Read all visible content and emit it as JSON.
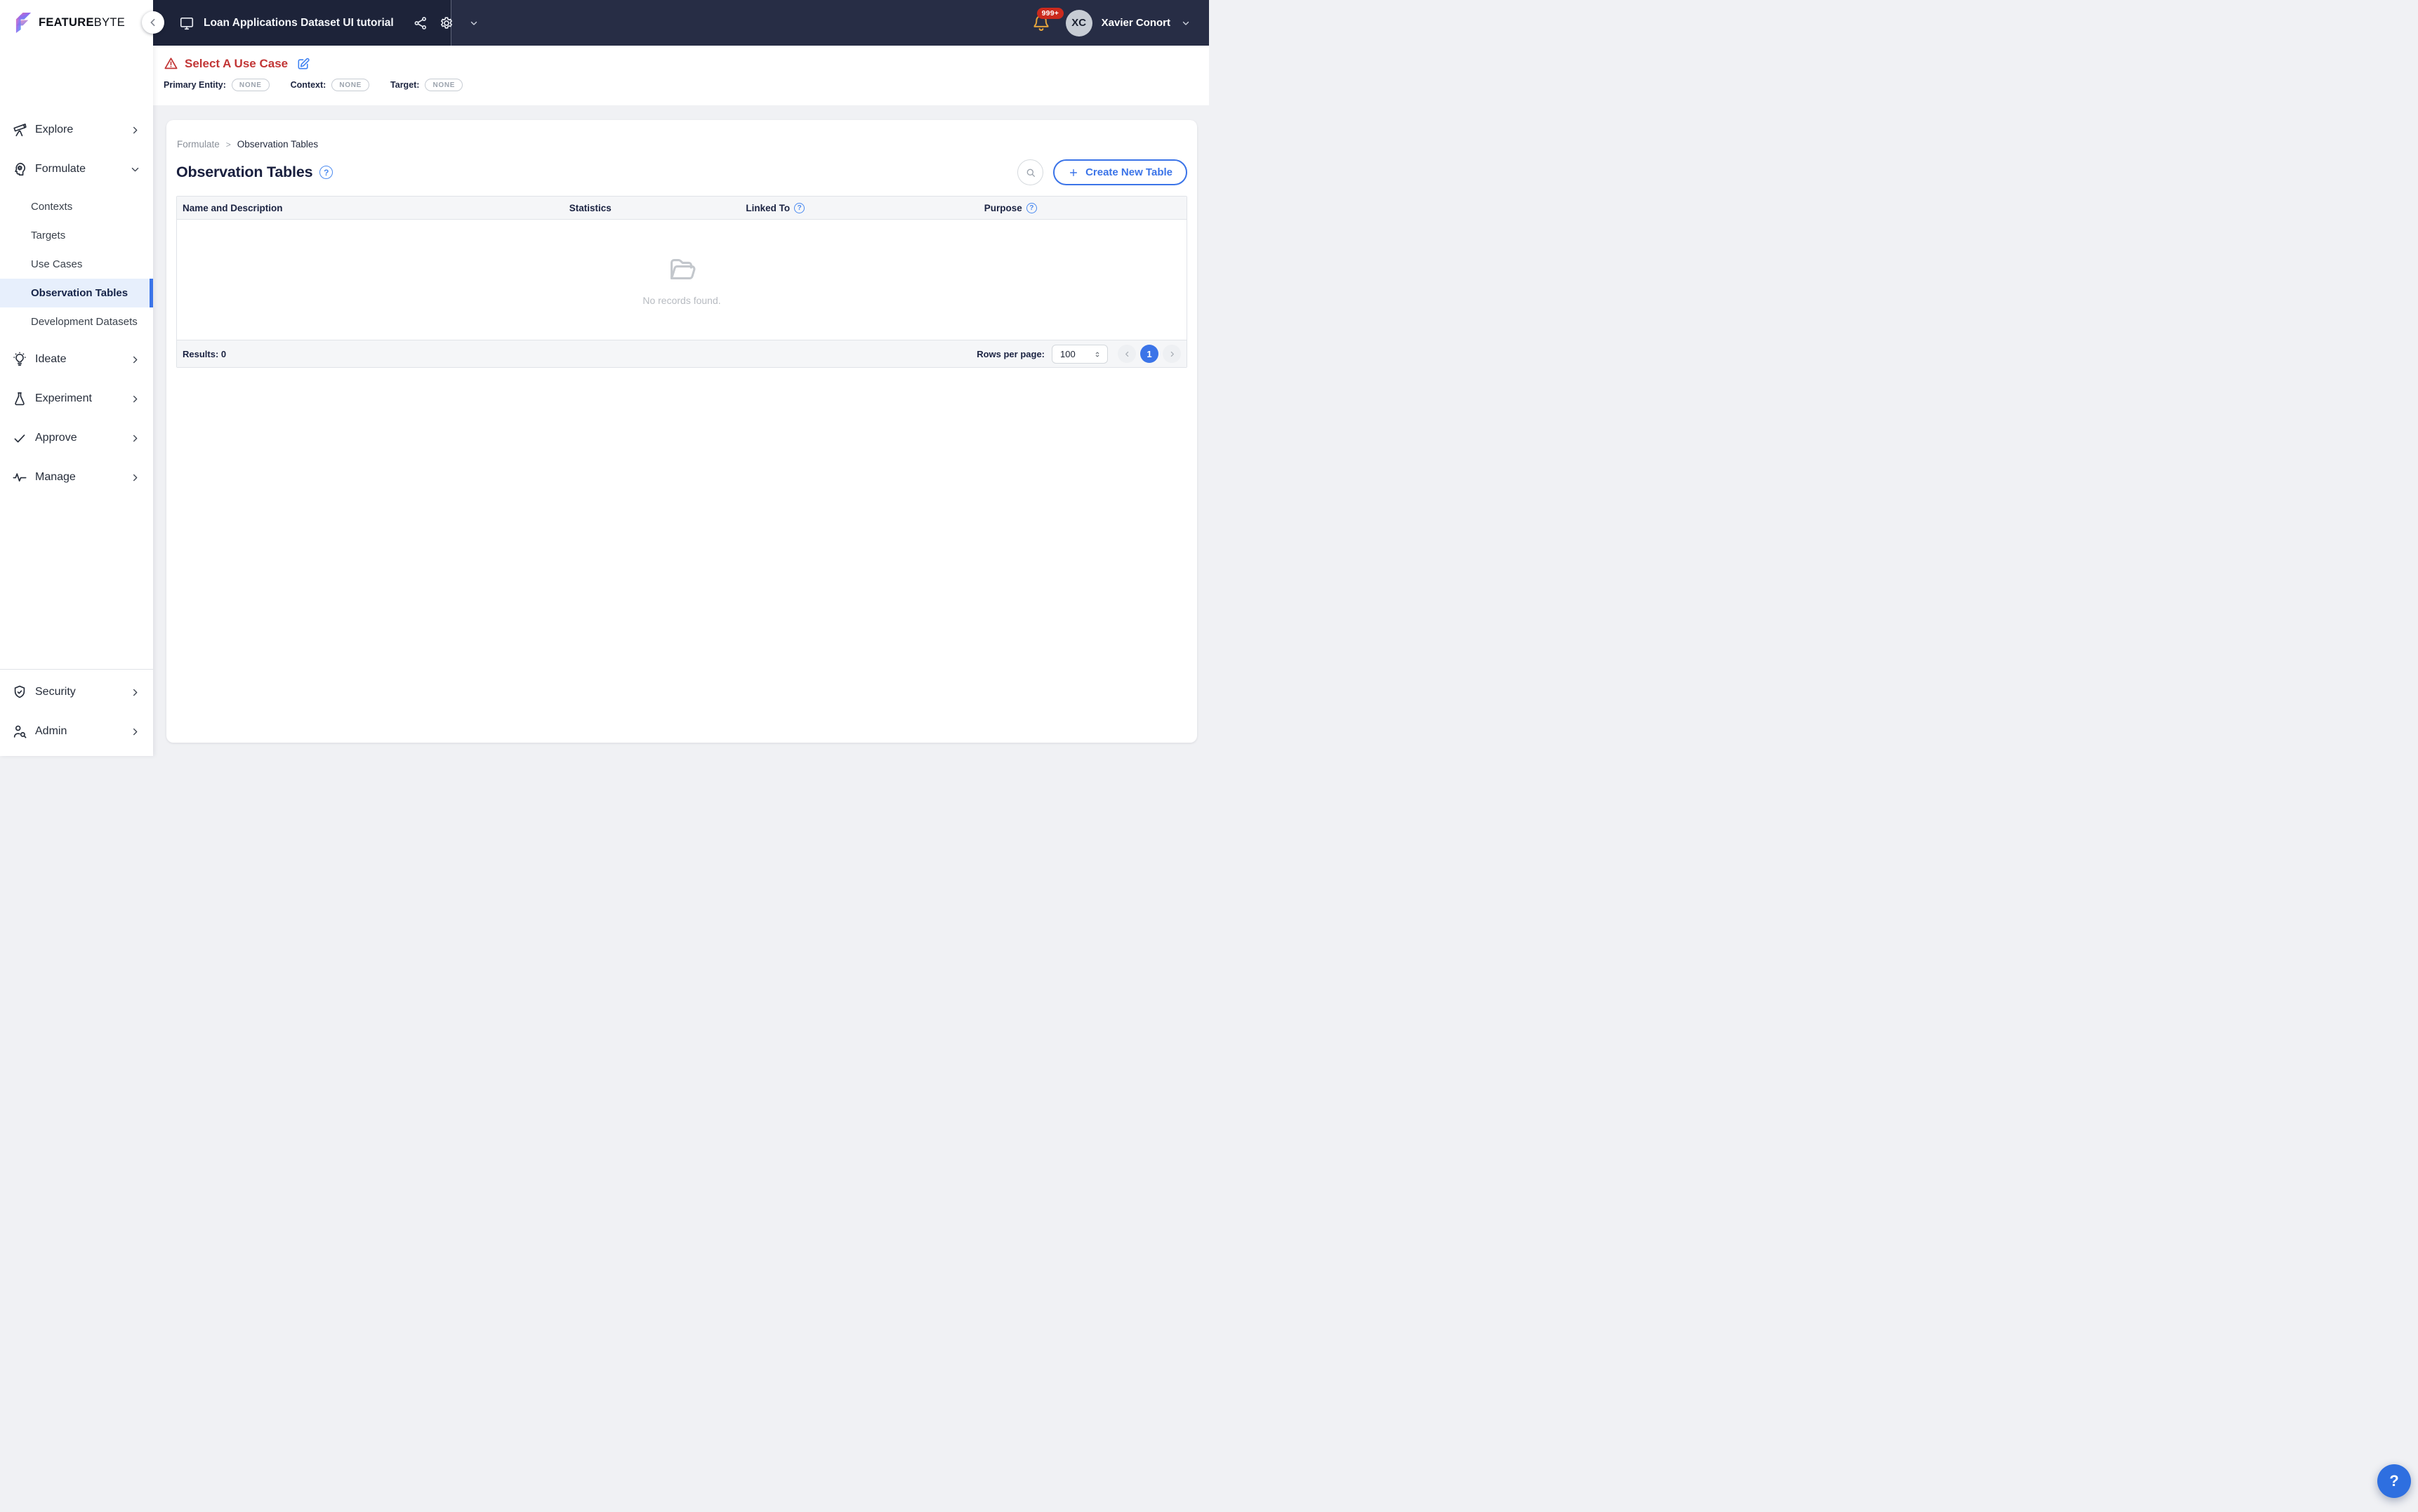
{
  "brand": {
    "name_bold": "FEATURE",
    "name_light": "BYTE",
    "logo_icon": "featurebyte-logo-icon"
  },
  "topbar": {
    "project_icon": "monitor-icon",
    "project_title": "Loan Applications Dataset UI tutorial",
    "action_icons": [
      "share-icon",
      "gear-icon",
      "chevron-down-icon"
    ],
    "notification_icon": "bell-icon",
    "notification_count": "999+",
    "user_initials": "XC",
    "user_name": "Xavier Conort"
  },
  "usecase_banner": {
    "warning_icon": "warning-triangle-icon",
    "title": "Select A Use Case",
    "edit_icon": "edit-pencil-icon",
    "fields": [
      {
        "label": "Primary Entity:",
        "value": "NONE"
      },
      {
        "label": "Context:",
        "value": "NONE"
      },
      {
        "label": "Target:",
        "value": "NONE"
      }
    ]
  },
  "breadcrumb": {
    "parent": "Formulate",
    "separator": ">",
    "current": "Observation Tables"
  },
  "page": {
    "title": "Observation Tables",
    "help_icon": "help-circle-icon"
  },
  "toolbar": {
    "search_icon": "search-icon",
    "create_label": "Create New Table",
    "plus_icon": "plus-icon"
  },
  "table": {
    "columns": [
      {
        "label": "Name and Description",
        "help": false
      },
      {
        "label": "Statistics",
        "help": false
      },
      {
        "label": "Linked To",
        "help": true
      },
      {
        "label": "Purpose",
        "help": true
      }
    ],
    "empty_icon": "folder-open-icon",
    "empty_text": "No records found."
  },
  "footer": {
    "results_label": "Results: 0",
    "rows_per_page_label": "Rows per page:",
    "rows_per_page_value": "100",
    "current_page": "1"
  },
  "sidebar": {
    "items": [
      {
        "label": "Explore",
        "icon": "telescope",
        "chevron": "right"
      },
      {
        "label": "Formulate",
        "icon": "head-gear",
        "chevron": "down",
        "expanded": true,
        "children": [
          {
            "label": "Contexts"
          },
          {
            "label": "Targets"
          },
          {
            "label": "Use Cases"
          },
          {
            "label": "Observation Tables",
            "selected": true
          },
          {
            "label": "Development Datasets"
          }
        ]
      },
      {
        "label": "Ideate",
        "icon": "lightbulb",
        "chevron": "right"
      },
      {
        "label": "Experiment",
        "icon": "flask",
        "chevron": "right"
      },
      {
        "label": "Approve",
        "icon": "check",
        "chevron": "right"
      },
      {
        "label": "Manage",
        "icon": "activity",
        "chevron": "right"
      }
    ],
    "bottom_items": [
      {
        "label": "Security",
        "icon": "shield-check",
        "chevron": "right"
      },
      {
        "label": "Admin",
        "icon": "user-search",
        "chevron": "right"
      }
    ]
  },
  "help_fab": {
    "label": "?"
  },
  "colors": {
    "accent_blue": "#3b74e8",
    "topbar_bg": "#272d45",
    "topbar_left_bg": "#1d2339",
    "danger_red": "#c23636",
    "selected_item_bg": "#e7effc",
    "badge_red": "#cb2a1d",
    "bell_gold": "#e3a33c",
    "page_bg": "#f0f1f4"
  }
}
